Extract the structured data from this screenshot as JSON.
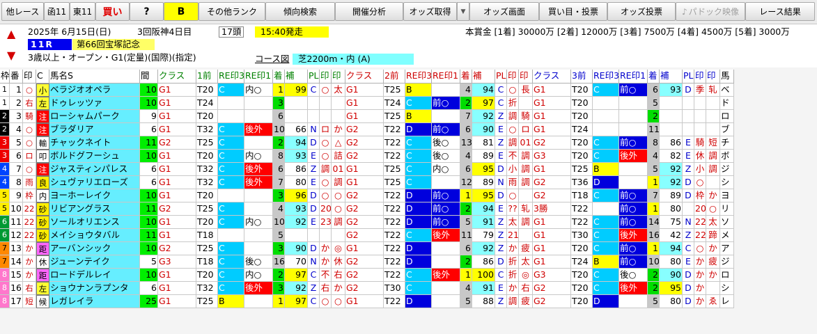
{
  "toolbar": {
    "buttons": [
      "他レース",
      "函11",
      "東11",
      "買い",
      "?",
      "B",
      "その他ランク",
      "傾向検索",
      "開催分析",
      "オッズ取得",
      "オッズ画面",
      "買い目・投票",
      "オッズ投票",
      "パドック映像",
      "レース結果"
    ]
  },
  "race": {
    "date": "2025年 6月15日(日)",
    "kaisai": "3回阪神4日目",
    "heads": "17頭",
    "start": "15:40発走",
    "prize": "本賞金 [1着] 30000万 [2着] 12000万 [3着] 7500万 [4着] 4500万 [5着] 3000万",
    "rno": "11R",
    "name": "第66回宝塚記念",
    "cond": "3歳以上・オープン・G1(定量)(国際)(指定)",
    "course_label": "コース図",
    "course": "芝2200m・内 (A)"
  },
  "headers": [
    "枠",
    "番",
    "印",
    "C",
    "馬名S",
    "間",
    "クラス",
    "1前",
    "RE印3",
    "RE印1",
    "着",
    "補",
    "PL",
    "印",
    "印",
    "クラス",
    "2前",
    "RE印3",
    "RE印1",
    "着",
    "補",
    "PL",
    "印",
    "印",
    "クラス",
    "3前",
    "RE印3",
    "RE印1",
    "着",
    "補",
    "PL",
    "印",
    "印",
    "馬"
  ],
  "rows": [
    {
      "waku": "1",
      "ban": "1",
      "mark": "○",
      "c": "小",
      "name": "ベラジオオペラ",
      "kan": "10",
      "p1": [
        "G1",
        "T20",
        "C",
        "内○",
        "1",
        "99",
        "C",
        "○",
        "太"
      ],
      "p2": [
        "G1",
        "T25",
        "B",
        "",
        "4",
        "94",
        "C",
        "○",
        "長"
      ],
      "p3": [
        "G1",
        "T20",
        "C",
        "前○",
        "6",
        "93",
        "D",
        "季",
        "轧"
      ],
      "tail": "ベ"
    },
    {
      "waku": "1",
      "ban": "2",
      "mark": "右",
      "c": "左",
      "name": "ドゥレッツァ",
      "kan": "10",
      "p1": [
        "G1",
        "T24",
        "",
        "",
        "3",
        "",
        "",
        "",
        ""
      ],
      "p2": [
        "G1",
        "T24",
        "C",
        "前○",
        "2",
        "97",
        "C",
        "折",
        ""
      ],
      "p3": [
        "G1",
        "T20",
        "",
        "",
        "5",
        "",
        "",
        "",
        ""
      ],
      "tail": "ド"
    },
    {
      "waku": "2",
      "ban": "3",
      "mark": "騎",
      "c": "注",
      "name": "ローシャムパーク",
      "kan": "9",
      "p1": [
        "G1",
        "T20",
        "",
        "",
        "6",
        "",
        "",
        "",
        ""
      ],
      "p2": [
        "G1",
        "T25",
        "B",
        "",
        "7",
        "92",
        "Z",
        "調",
        "騎"
      ],
      "p3": [
        "G1",
        "T20",
        "",
        "",
        "2",
        "",
        "",
        "",
        ""
      ],
      "tail": "ロ"
    },
    {
      "waku": "2",
      "ban": "4",
      "mark": "○",
      "c": "注",
      "name": "ブラダリア",
      "kan": "6",
      "p1": [
        "G1",
        "T32",
        "C",
        "後外",
        "10",
        "66",
        "N",
        "ロ",
        "か"
      ],
      "p2": [
        "G2",
        "T22",
        "D",
        "前○",
        "6",
        "90",
        "E",
        "○",
        "ロ"
      ],
      "p3": [
        "G1",
        "T24",
        "",
        "",
        "11",
        "",
        "",
        "",
        ""
      ],
      "tail": "ブ"
    },
    {
      "waku": "3",
      "ban": "5",
      "mark": "○",
      "c": "輸",
      "name": "チャックネイト",
      "kan": "11",
      "p1": [
        "G2",
        "T25",
        "C",
        "",
        "2",
        "94",
        "D",
        "○",
        "△"
      ],
      "p2": [
        "G2",
        "T22",
        "C",
        "後○",
        "13",
        "81",
        "Z",
        "調",
        "01"
      ],
      "p3": [
        "G2",
        "T20",
        "C",
        "前○",
        "8",
        "86",
        "E",
        "騎",
        "短"
      ],
      "tail": "チ"
    },
    {
      "waku": "3",
      "ban": "6",
      "mark": "ロ",
      "c": "叩",
      "name": "ボルドグフーシュ",
      "kan": "10",
      "p1": [
        "G1",
        "T20",
        "C",
        "内○",
        "8",
        "93",
        "E",
        "○",
        "詰"
      ],
      "p2": [
        "G2",
        "T22",
        "C",
        "後○",
        "4",
        "89",
        "E",
        "不",
        "調"
      ],
      "p3": [
        "G3",
        "T20",
        "C",
        "後外",
        "4",
        "82",
        "E",
        "休",
        "調"
      ],
      "tail": "ボ"
    },
    {
      "waku": "4",
      "ban": "7",
      "mark": "○",
      "c": "注",
      "name": "ジャスティンパレス",
      "kan": "6",
      "p1": [
        "G1",
        "T32",
        "C",
        "後外",
        "6",
        "86",
        "Z",
        "調",
        "01"
      ],
      "p2": [
        "G1",
        "T25",
        "C",
        "内○",
        "6",
        "95",
        "D",
        "小",
        "調"
      ],
      "p3": [
        "G1",
        "T25",
        "B",
        "",
        "5",
        "92",
        "Z",
        "小",
        "調"
      ],
      "tail": "ジ"
    },
    {
      "waku": "4",
      "ban": "8",
      "mark": "雨",
      "c": "良",
      "name": "シュヴァリエローズ",
      "kan": "6",
      "p1": [
        "G1",
        "T32",
        "C",
        "後外",
        "7",
        "80",
        "E",
        "○",
        "調"
      ],
      "p2": [
        "G1",
        "T25",
        "C",
        "",
        "12",
        "89",
        "N",
        "雨",
        "調"
      ],
      "p3": [
        "G2",
        "T36",
        "D",
        "",
        "1",
        "92",
        "D",
        "○",
        ""
      ],
      "tail": "シ"
    },
    {
      "waku": "5",
      "ban": "9",
      "mark": "枠",
      "c": "内",
      "name": "ヨーホーレイク",
      "kan": "10",
      "p1": [
        "G1",
        "T20",
        "",
        "",
        "3",
        "96",
        "D",
        "○",
        "○"
      ],
      "p2": [
        "G2",
        "T22",
        "D",
        "前○",
        "1",
        "95",
        "D",
        "○",
        ""
      ],
      "p3": [
        "G2",
        "T18",
        "C",
        "前○",
        "7",
        "89",
        "D",
        "枠",
        "か"
      ],
      "tail": "ヨ"
    },
    {
      "waku": "5",
      "ban": "10",
      "mark": "22",
      "c": "砂",
      "name": "リビアングラス",
      "kan": "11",
      "p1": [
        "G2",
        "T25",
        "C",
        "",
        "4",
        "93",
        "D",
        "20",
        "○"
      ],
      "p2": [
        "G2",
        "T22",
        "D",
        "前○",
        "2",
        "94",
        "E",
        "??",
        "轧"
      ],
      "p3": [
        "3勝",
        "T22",
        "",
        "前○",
        "1",
        "80",
        "",
        "20",
        "○"
      ],
      "tail": "リ"
    },
    {
      "waku": "6",
      "ban": "11",
      "mark": "22",
      "c": "砂",
      "name": "ソールオリエンス",
      "kan": "10",
      "p1": [
        "G1",
        "T20",
        "C",
        "内○",
        "10",
        "92",
        "E",
        "23",
        "調"
      ],
      "p2": [
        "G2",
        "T22",
        "D",
        "前○",
        "5",
        "91",
        "Z",
        "太",
        "調"
      ],
      "p3": [
        "G1",
        "T22",
        "C",
        "前○",
        "14",
        "75",
        "N",
        "22",
        "太"
      ],
      "tail": "ソ"
    },
    {
      "waku": "6",
      "ban": "12",
      "mark": "22",
      "c": "砂",
      "name": "メイショウタバル",
      "kan": "11",
      "p1": [
        "G1",
        "T18",
        "",
        "",
        "5",
        "",
        "",
        "",
        ""
      ],
      "p2": [
        "G2",
        "T22",
        "C",
        "後外",
        "11",
        "79",
        "Z",
        "21",
        ""
      ],
      "p3": [
        "G1",
        "T30",
        "C",
        "後外",
        "16",
        "42",
        "Z",
        "22",
        "蹄"
      ],
      "tail": "メ"
    },
    {
      "waku": "7",
      "ban": "13",
      "mark": "か",
      "c": "距",
      "name": "アーバンシック",
      "kan": "10",
      "p1": [
        "G2",
        "T25",
        "C",
        "",
        "3",
        "90",
        "D",
        "か",
        "◎"
      ],
      "p2": [
        "G1",
        "T22",
        "D",
        "",
        "6",
        "92",
        "Z",
        "か",
        "疲"
      ],
      "p3": [
        "G1",
        "T20",
        "C",
        "前○",
        "1",
        "94",
        "C",
        "○",
        "か"
      ],
      "tail": "ア"
    },
    {
      "waku": "7",
      "ban": "14",
      "mark": "か",
      "c": "休",
      "name": "ジューンテイク",
      "kan": "5",
      "p1": [
        "G3",
        "T18",
        "C",
        "後○",
        "16",
        "70",
        "N",
        "か",
        "休"
      ],
      "p2": [
        "G2",
        "T22",
        "D",
        "",
        "2",
        "86",
        "D",
        "折",
        "太"
      ],
      "p3": [
        "G1",
        "T24",
        "B",
        "前○",
        "10",
        "80",
        "E",
        "か",
        "疲"
      ],
      "tail": "ジ"
    },
    {
      "waku": "8",
      "ban": "15",
      "mark": "か",
      "c": "距",
      "name": "ロードデルレイ",
      "kan": "10",
      "p1": [
        "G1",
        "T20",
        "C",
        "内○",
        "2",
        "97",
        "C",
        "不",
        "右"
      ],
      "p2": [
        "G2",
        "T22",
        "C",
        "後外",
        "1",
        "100",
        "C",
        "折",
        "◎"
      ],
      "p3": [
        "G3",
        "T20",
        "C",
        "後○",
        "2",
        "90",
        "D",
        "か",
        "か"
      ],
      "tail": "ロ"
    },
    {
      "waku": "8",
      "ban": "16",
      "mark": "右",
      "c": "左",
      "name": "ショウナンラプンタ",
      "kan": "6",
      "p1": [
        "G1",
        "T32",
        "C",
        "後外",
        "3",
        "92",
        "Z",
        "右",
        "か"
      ],
      "p2": [
        "G2",
        "T30",
        "C",
        "",
        "4",
        "91",
        "E",
        "か",
        "右"
      ],
      "p3": [
        "G2",
        "T20",
        "C",
        "後外",
        "2",
        "95",
        "D",
        "か",
        ""
      ],
      "tail": "シ"
    },
    {
      "waku": "8",
      "ban": "17",
      "mark": "短",
      "c": "候",
      "name": "レガレイラ",
      "kan": "25",
      "p1": [
        "G1",
        "T25",
        "B",
        "",
        "1",
        "97",
        "C",
        "○",
        "○"
      ],
      "p2": [
        "G1",
        "T22",
        "D",
        "",
        "5",
        "88",
        "Z",
        "調",
        "疲"
      ],
      "p3": [
        "G2",
        "T20",
        "D",
        "",
        "5",
        "80",
        "D",
        "か",
        "ゑ"
      ],
      "tail": "レ"
    }
  ]
}
